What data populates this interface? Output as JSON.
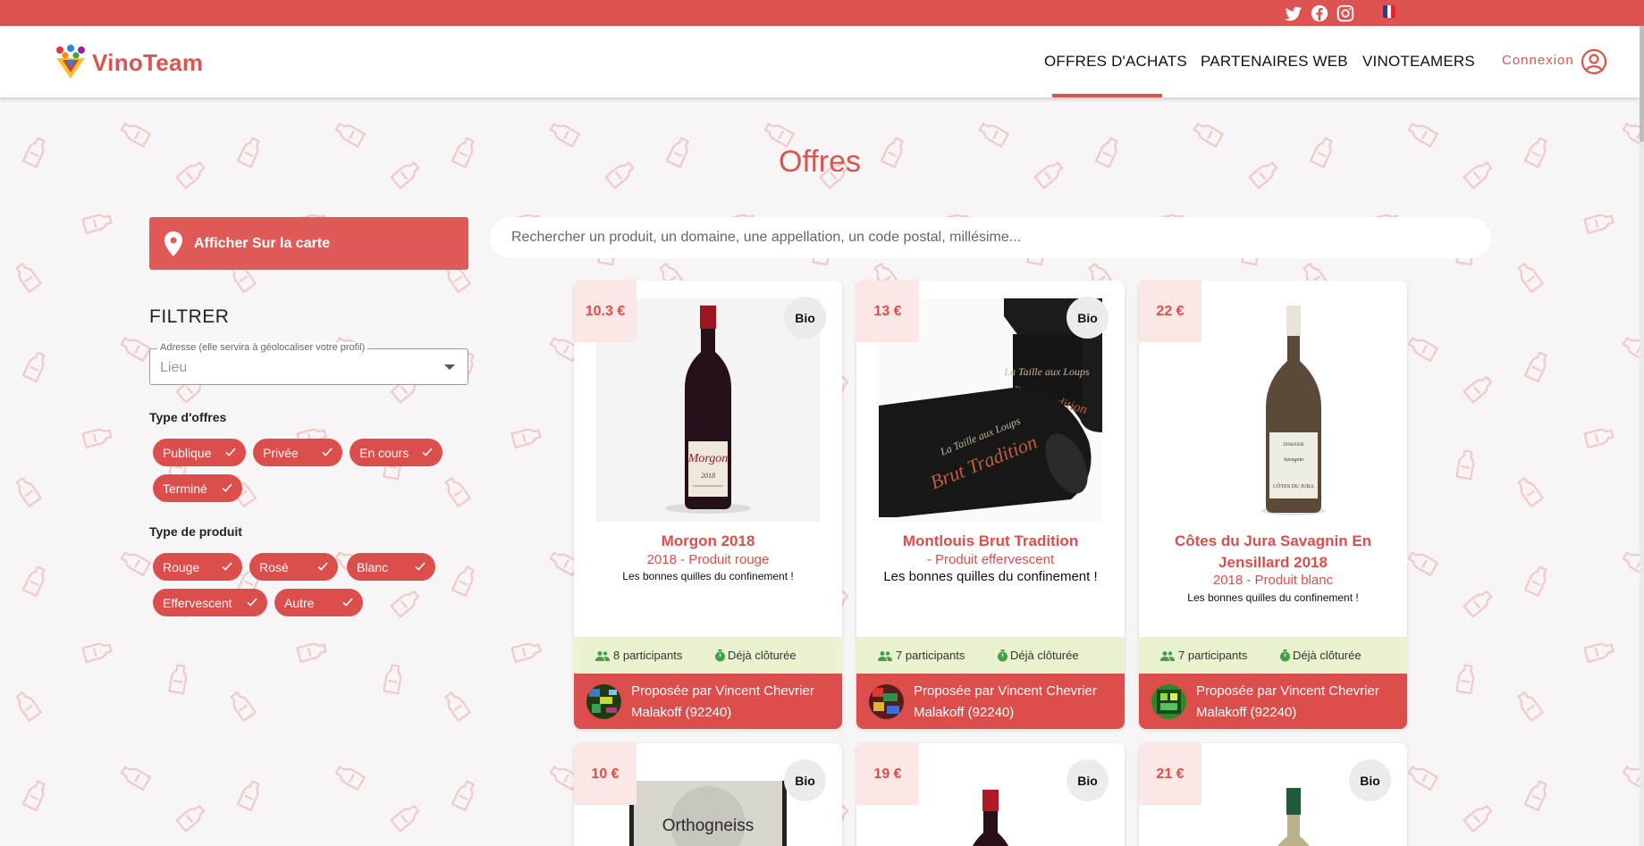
{
  "header": {
    "brand": "VinoTeam",
    "nav": [
      "OFFRES D'ACHATS",
      "PARTENAIRES WEB",
      "VINOTEAMERS"
    ],
    "connexion": "Connexion"
  },
  "page_title": "Offres",
  "map_button": "Afficher Sur la carte",
  "search": {
    "placeholder": "Rechercher un produit, un domaine, une appellation, un code postal, millésime..."
  },
  "filters": {
    "title": "FILTRER",
    "address": {
      "label": "Adresse (elle servira à géolocaliser votre profil)",
      "value": "Lieu"
    },
    "offer_type_label": "Type d'offres",
    "offer_types": [
      "Publique",
      "Privée",
      "En cours",
      "Terminé"
    ],
    "product_type_label": "Type de produit",
    "product_types": [
      "Rouge",
      "Rosé",
      "Blanc",
      "Effervescent",
      "Autre"
    ]
  },
  "offers": [
    {
      "price": "10.3 €",
      "bio": "Bio",
      "name": "Morgon 2018",
      "subtitle": "2018 - Produit rouge",
      "description": "Les bonnes quilles du confinement !",
      "participants": "8 participants",
      "status": "Déjà clôturée",
      "proposed_by": "Proposée par Vincent Chevrier",
      "location": "Malakoff (92240)"
    },
    {
      "price": "13 €",
      "bio": "Bio",
      "name": "Montlouis Brut Tradition",
      "subtitle": "- Produit effervescent",
      "description": "Les bonnes quilles du confinement !",
      "participants": "7 participants",
      "status": "Déjà clôturée",
      "proposed_by": "Proposée par Vincent Chevrier",
      "location": "Malakoff (92240)"
    },
    {
      "price": "22 €",
      "bio": "",
      "name": "Côtes du Jura Savagnin En Jensillard 2018",
      "subtitle": "2018 - Produit blanc",
      "description": "Les bonnes quilles du confinement !",
      "participants": "7 participants",
      "status": "Déjà clôturée",
      "proposed_by": "Proposée par Vincent Chevrier",
      "location": "Malakoff (92240)"
    },
    {
      "price": "10 €",
      "bio": "Bio",
      "label_text": "Orthogneiss"
    },
    {
      "price": "19 €",
      "bio": "Bio"
    },
    {
      "price": "21 €",
      "bio": "Bio"
    }
  ],
  "colors": {
    "brand": "#dc5350",
    "stats_bg": "#eaf3cf",
    "price_bg": "#fbe7e6"
  }
}
